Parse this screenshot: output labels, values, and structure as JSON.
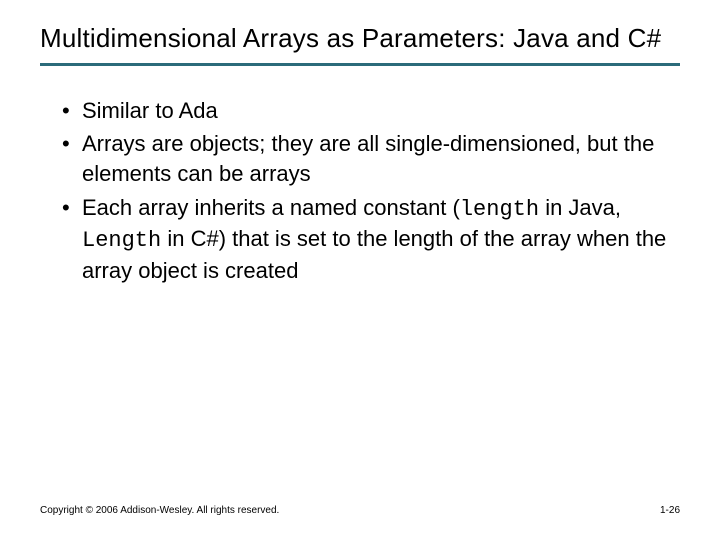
{
  "title": "Multidimensional Arrays as Parameters: Java and C#",
  "bullets": {
    "b1": "Similar to Ada",
    "b2": "Arrays are objects; they are all single-dimensioned, but the elements can be arrays",
    "b3_pre": "Each array inherits a named constant (",
    "b3_code1": "length",
    "b3_mid1": " in Java, ",
    "b3_code2": "Length",
    "b3_mid2": " in C#) that is set to the length of the array when the array object is created"
  },
  "footer": {
    "copyright": "Copyright © 2006 Addison-Wesley. All rights reserved.",
    "pagenum": "1-26"
  }
}
